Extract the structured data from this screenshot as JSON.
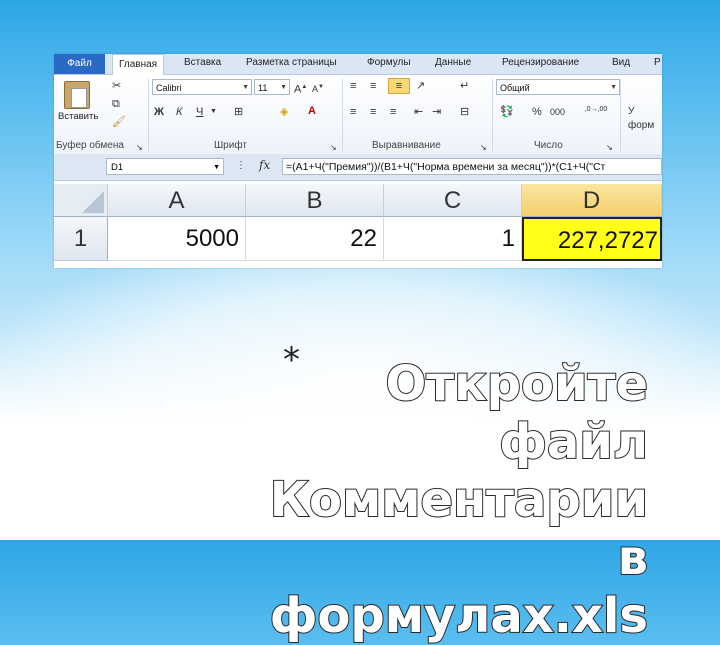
{
  "menu": {
    "tabs": [
      "Файл",
      "Главная",
      "Вставка",
      "Разметка страницы",
      "Формулы",
      "Данные",
      "Рецензирование",
      "Вид",
      "Р"
    ]
  },
  "ribbon": {
    "clipboard": {
      "paste_label": "Вставить",
      "group_label": "Буфер обмена"
    },
    "font": {
      "name": "Calibri",
      "size": "11",
      "bold": "Ж",
      "italic": "К",
      "underline": "Ч",
      "group_label": "Шрифт"
    },
    "alignment": {
      "group_label": "Выравнивание"
    },
    "number": {
      "format": "Общий",
      "percent": "%",
      "thousands": "000",
      "inc_dec": ",0→,00",
      "group_label": "Число"
    },
    "styles": {
      "label1": "У",
      "label2": "форм"
    }
  },
  "formula_bar": {
    "name_box": "D1",
    "fx": "fx",
    "formula": "=(A1+Ч(\"Премия\"))/(B1+Ч(\"Норма времени за месяц\"))*(C1+Ч(\"Ст"
  },
  "sheet": {
    "columns": [
      "A",
      "B",
      "C",
      "D"
    ],
    "rows": [
      {
        "header": "1",
        "cells": [
          "5000",
          "22",
          "1",
          "227,2727"
        ]
      }
    ],
    "selected_cell": "D1",
    "selected_fill": "#ffff1a"
  },
  "slide": {
    "bullet": "*",
    "title_lines": [
      "Откройте файл",
      "Комментарии в",
      "формулах.xls"
    ]
  }
}
